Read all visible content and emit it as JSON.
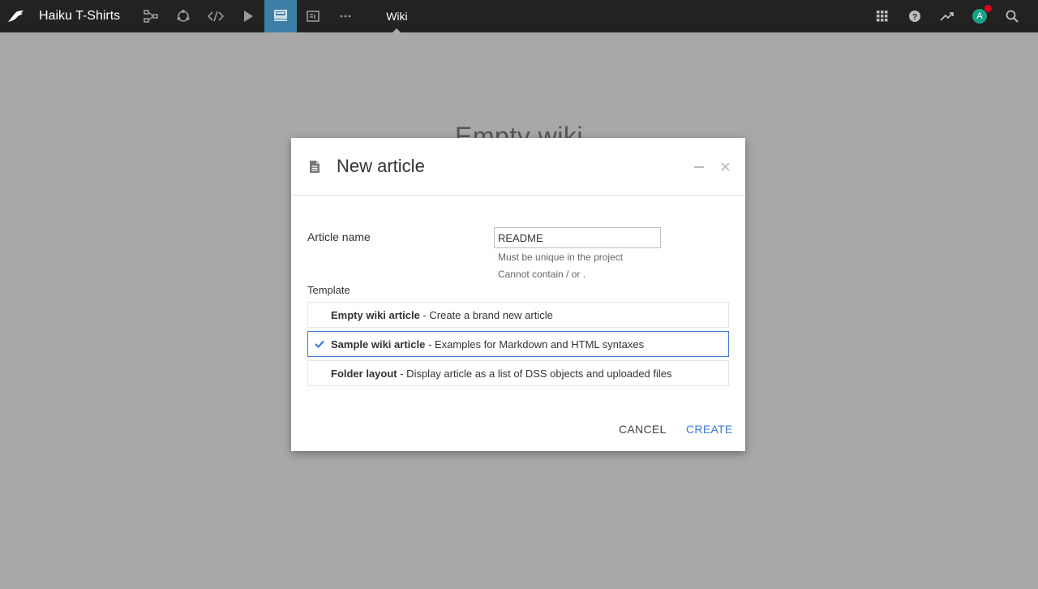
{
  "topbar": {
    "project_title": "Haiku T-Shirts",
    "active_tab": "Wiki",
    "nav_icons": [
      "flow-icon",
      "lab-icon",
      "code-icon",
      "run-icon",
      "wiki-icon",
      "dashboard-icon",
      "more-icon"
    ],
    "right_icons": [
      "apps-grid-icon",
      "help-icon",
      "activity-icon",
      "avatar",
      "search-icon"
    ],
    "avatar_letter": "A",
    "colors": {
      "bar": "#222222",
      "active": "#3e7fa8",
      "avatar": "#17a38a",
      "notification": "#d9001b"
    }
  },
  "background": {
    "title": "Empty wiki"
  },
  "modal": {
    "title": "New article",
    "article_name_label": "Article name",
    "article_name_value": "README",
    "help_unique": "Must be unique in the project",
    "help_chars": "Cannot contain / or .",
    "template_label": "Template",
    "templates": [
      {
        "name": "Empty wiki article",
        "description": " - Create a brand new article",
        "selected": false
      },
      {
        "name": "Sample wiki article",
        "description": " - Examples for Markdown and HTML syntaxes",
        "selected": true
      },
      {
        "name": "Folder layout",
        "description": " - Display article as a list of DSS objects and uploaded files",
        "selected": false
      }
    ],
    "cancel_label": "CANCEL",
    "create_label": "CREATE",
    "accent_color": "#3b7bd4"
  }
}
